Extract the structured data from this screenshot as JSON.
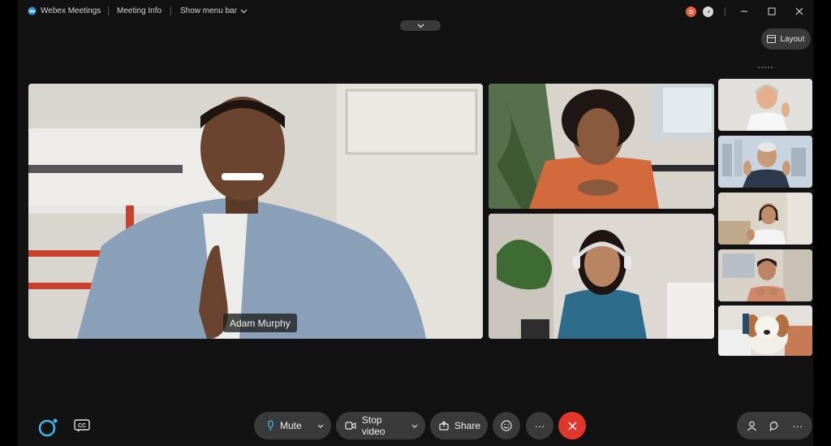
{
  "titlebar": {
    "app_name": "Webex Meetings",
    "meeting_info": "Meeting Info",
    "show_menu_bar": "Show menu bar"
  },
  "toolbar": {
    "layout_label": "Layout"
  },
  "stage": {
    "active_speaker_name": "Adam Murphy"
  },
  "controls": {
    "mute_label": "Mute",
    "stop_video_label": "Stop video",
    "share_label": "Share",
    "more_glyph": "···"
  },
  "colors": {
    "accent_blue": "#3fb7e8",
    "end_call_red": "#e0362b",
    "record_orange": "#e8633a",
    "control_gray": "#3a3a3a",
    "background": "#121212"
  },
  "icons": [
    "webex-logo-icon",
    "chevron-down-icon",
    "recording-icon",
    "compass-icon",
    "minimize-icon",
    "maximize-icon",
    "close-icon",
    "layout-icon",
    "assistant-icon",
    "closed-captions-icon",
    "microphone-icon",
    "camera-icon",
    "share-icon",
    "reactions-icon",
    "end-call-icon",
    "participants-icon",
    "chat-icon",
    "more-options-icon"
  ]
}
